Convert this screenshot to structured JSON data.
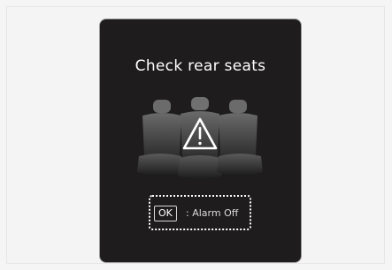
{
  "screen": {
    "title": "Check rear seats",
    "icon": "rear-seats-warning-icon"
  },
  "hint": {
    "key_label": "OK",
    "separator": ":",
    "action_label": "Alarm Off"
  }
}
